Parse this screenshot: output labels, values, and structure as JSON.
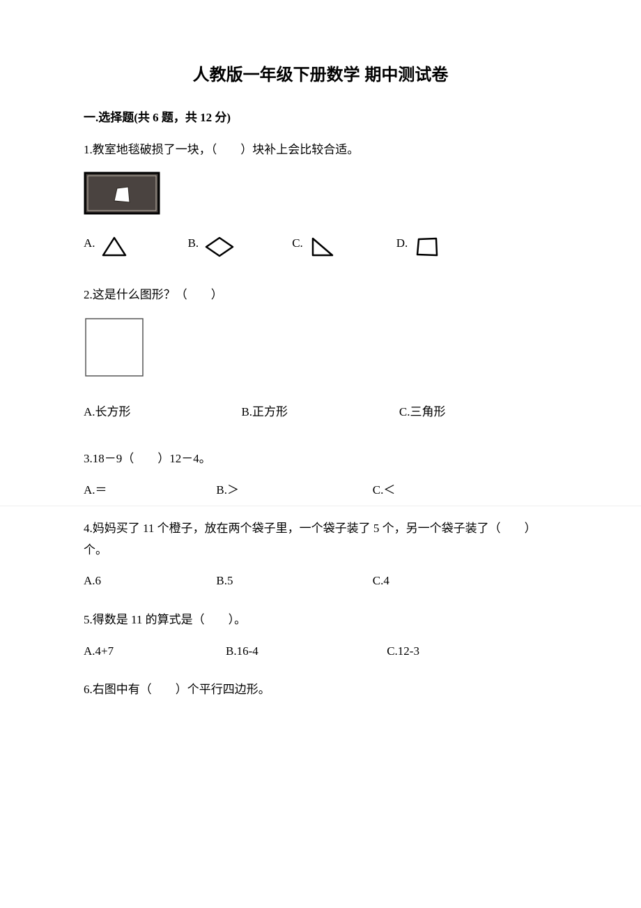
{
  "title": "人教版一年级下册数学 期中测试卷",
  "section1": {
    "header": "一.选择题(共 6 题，共 12 分)"
  },
  "q1": {
    "text": "1.教室地毯破损了一块，（　　）块补上会比较合适。",
    "a": "A.",
    "b": "B.",
    "c": "C.",
    "d": "D."
  },
  "q2": {
    "text": "2.这是什么图形？（　　）",
    "a": "A.长方形",
    "b": "B.正方形",
    "c": "C.三角形"
  },
  "q3": {
    "text": "3.18－9（　　）12－4。",
    "a": "A.＝",
    "b": "B.＞",
    "c": "C.＜"
  },
  "q4": {
    "text": "4.妈妈买了 11 个橙子，放在两个袋子里，一个袋子装了 5 个，另一个袋子装了（　　）个。",
    "a": "A.6",
    "b": "B.5",
    "c": "C.4"
  },
  "q5": {
    "text": "5.得数是 11 的算式是（　　）。",
    "a": "A.4+7",
    "b": "B.16-4",
    "c": "C.12-3"
  },
  "q6": {
    "text": "6.右图中有（　　）个平行四边形。"
  }
}
